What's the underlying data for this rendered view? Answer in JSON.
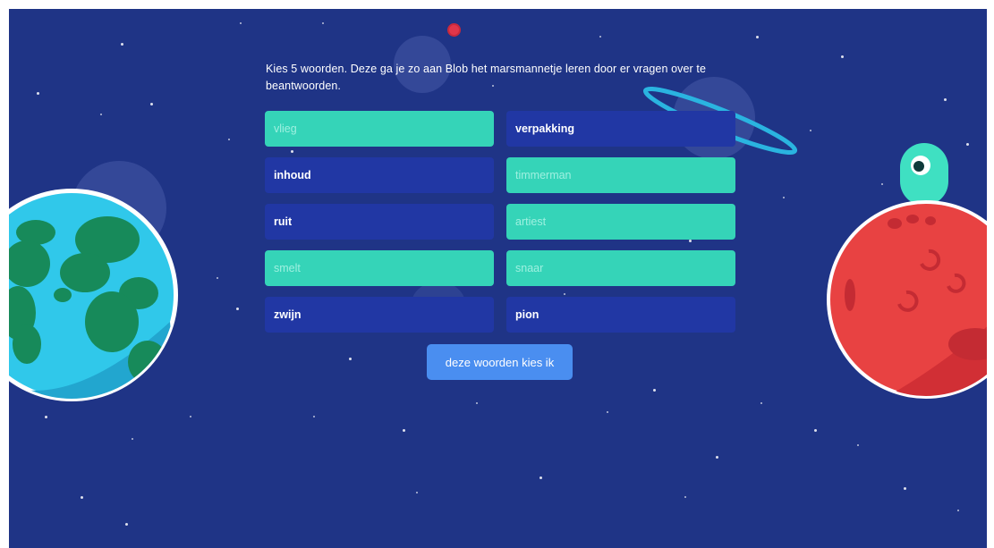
{
  "instruction": "Kies 5 woorden. Deze ga je zo aan Blob het marsmannetje leren door er vragen over te beantwoorden.",
  "words": [
    {
      "label": "vlieg",
      "selected": true
    },
    {
      "label": "verpakking",
      "selected": false
    },
    {
      "label": "inhoud",
      "selected": false
    },
    {
      "label": "timmerman",
      "selected": true
    },
    {
      "label": "ruit",
      "selected": false
    },
    {
      "label": "artiest",
      "selected": true
    },
    {
      "label": "smelt",
      "selected": true
    },
    {
      "label": "snaar",
      "selected": true
    },
    {
      "label": "zwijn",
      "selected": false
    },
    {
      "label": "pion",
      "selected": false
    }
  ],
  "confirm_label": "deze woorden kies ik",
  "colors": {
    "background": "#1f3486",
    "word_unselected": "#2137a4",
    "word_selected": "#35d4b8",
    "button": "#4a8ef0",
    "earth_ocean": "#30c8ea",
    "earth_land": "#178a5a",
    "mars": "#e84242",
    "alien": "#3fe0c2"
  },
  "icons": [
    "earth-planet",
    "mars-planet",
    "blob-alien",
    "ringed-planet",
    "stars"
  ]
}
